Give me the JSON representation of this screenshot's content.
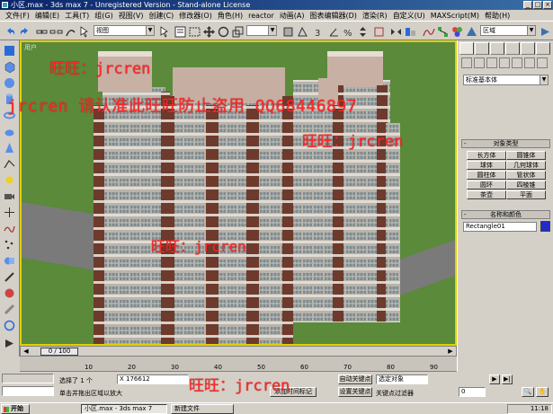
{
  "window": {
    "title": "小区.max - 3ds max 7 - Unregistered Version - Stand-alone License",
    "buttons": [
      "_",
      "□",
      "×"
    ]
  },
  "menu": [
    "文件(F)",
    "编辑(E)",
    "工具(T)",
    "组(G)",
    "视图(V)",
    "创建(C)",
    "修改器(O)",
    "角色(H)",
    "reactor",
    "动画(A)",
    "图表编辑器(D)",
    "渲染(R)",
    "自定义(U)",
    "MAXScript(M)",
    "帮助(H)"
  ],
  "toolbar": {
    "view_dropdown": "视图",
    "selection_set": "区域"
  },
  "viewport": {
    "label": "用户"
  },
  "timeslider": {
    "position": "0 / 100",
    "current_frame": 0,
    "total_frames": 100
  },
  "trackbar": {
    "ticks": [
      "10",
      "20",
      "30",
      "40",
      "50",
      "60",
      "70",
      "80",
      "90"
    ]
  },
  "status": {
    "selection": "选择了 1 个",
    "coord_x": "X 176612",
    "prompt": "单击并拖出区域以放大",
    "add_time_tag": "添加时间标记",
    "auto_key": "自动关键点",
    "set_key": "设置关键点",
    "key_filter": "关键点过滤器",
    "selected_object": "选定对象",
    "frame_value": "0"
  },
  "taskbar": {
    "start": "开始",
    "items": [
      "小区.max - 3ds max 7",
      "新建文件"
    ],
    "clock": "11:18"
  },
  "command_panel": {
    "category": "标准基本体",
    "object_type_title": "对象类型",
    "objects": [
      "长方体",
      "圆锥体",
      "球体",
      "几何球体",
      "圆柱体",
      "管状体",
      "圆环",
      "四棱锥",
      "茶壶",
      "平面"
    ],
    "name_color_title": "名称和颜色",
    "object_name": "Rectangle01",
    "object_color": "#1f2cc8"
  },
  "watermarks": {
    "w1": "旺旺：jrcren",
    "w2": "jrcren 请认准此旺旺防止盗用 QQ68446897",
    "w3": "旺旺：jrcren",
    "w4": "旺旺：jrcren",
    "w5": "旺旺：jrcren"
  }
}
